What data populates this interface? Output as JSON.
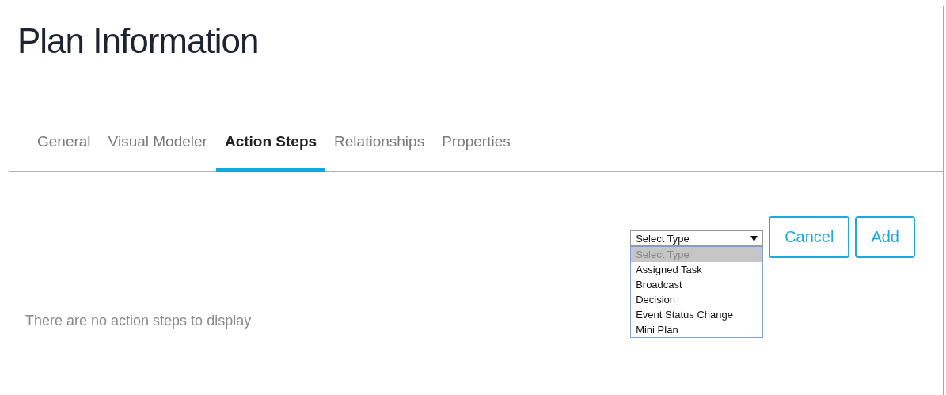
{
  "title": "Plan Information",
  "tabs": [
    {
      "label": "General",
      "selected": false
    },
    {
      "label": "Visual Modeler",
      "selected": false
    },
    {
      "label": "Action Steps",
      "selected": true
    },
    {
      "label": "Relationships",
      "selected": false
    },
    {
      "label": "Properties",
      "selected": false
    }
  ],
  "empty_message": "There are no action steps to display",
  "type_select": {
    "value": "Select Type",
    "expanded": true,
    "options": [
      {
        "label": "Select Type",
        "selected": true
      },
      {
        "label": "Assigned Task",
        "selected": false
      },
      {
        "label": "Broadcast",
        "selected": false
      },
      {
        "label": "Decision",
        "selected": false
      },
      {
        "label": "Event Status Change",
        "selected": false
      },
      {
        "label": "Mini Plan",
        "selected": false
      }
    ]
  },
  "buttons": [
    "Cancel",
    "Add"
  ]
}
